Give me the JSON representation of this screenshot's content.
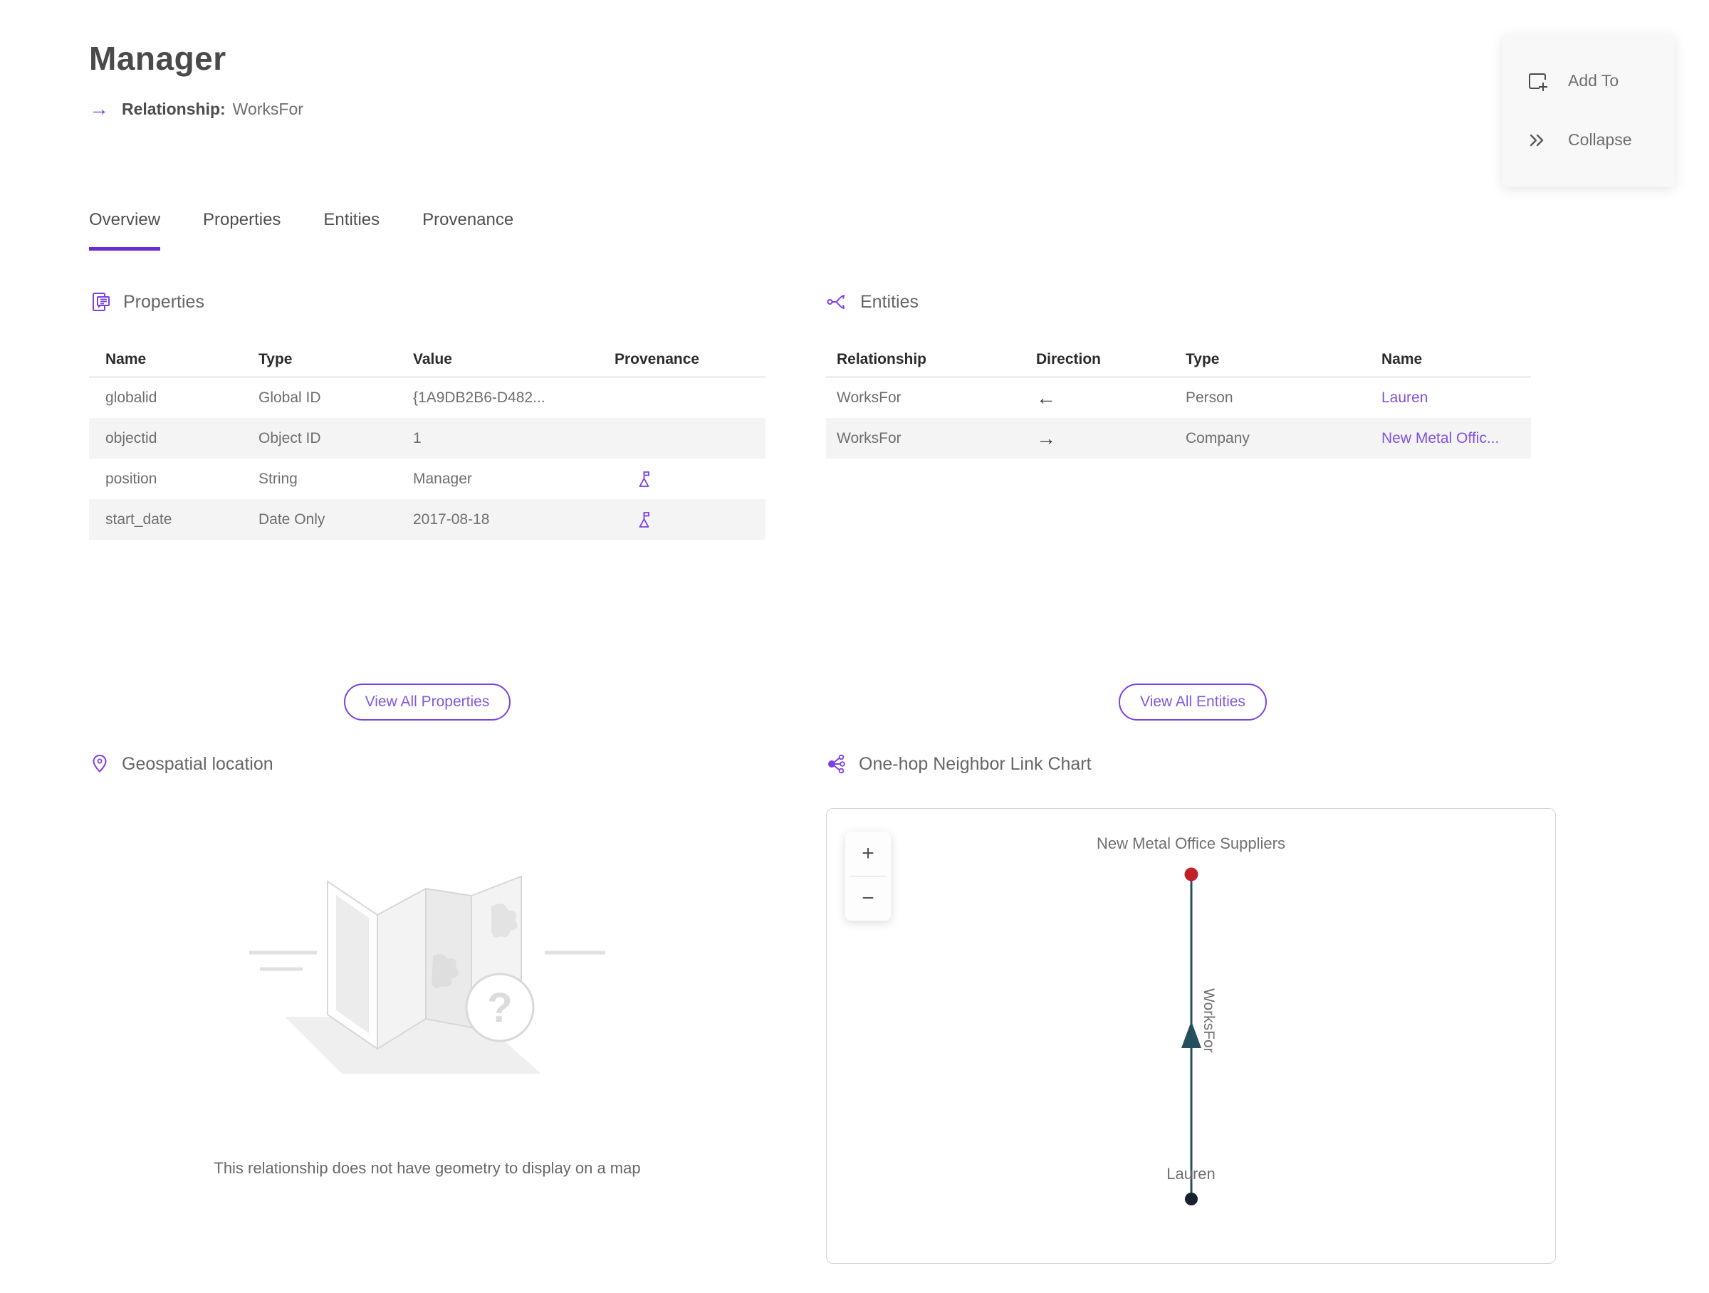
{
  "page": {
    "title": "Manager",
    "subtitle_label": "Relationship:",
    "subtitle_value": "WorksFor"
  },
  "actions": {
    "add_to": "Add To",
    "collapse": "Collapse"
  },
  "tabs": [
    {
      "label": "Overview",
      "active": true
    },
    {
      "label": "Properties",
      "active": false
    },
    {
      "label": "Entities",
      "active": false
    },
    {
      "label": "Provenance",
      "active": false
    }
  ],
  "properties_section": {
    "title": "Properties",
    "columns": [
      "Name",
      "Type",
      "Value",
      "Provenance"
    ],
    "rows": [
      {
        "name": "globalid",
        "type": "Global ID",
        "value": "{1A9DB2B6-D482...",
        "has_provenance_flag": false
      },
      {
        "name": "objectid",
        "type": "Object ID",
        "value": "1",
        "has_provenance_flag": false
      },
      {
        "name": "position",
        "type": "String",
        "value": "Manager",
        "has_provenance_flag": true
      },
      {
        "name": "start_date",
        "type": "Date Only",
        "value": "2017-08-18",
        "has_provenance_flag": true
      }
    ],
    "view_all_label": "View All Properties"
  },
  "entities_section": {
    "title": "Entities",
    "columns": [
      "Relationship",
      "Direction",
      "Type",
      "Name"
    ],
    "rows": [
      {
        "relationship": "WorksFor",
        "direction": "←",
        "type": "Person",
        "name": "Lauren"
      },
      {
        "relationship": "WorksFor",
        "direction": "→",
        "type": "Company",
        "name": "New Metal Offic..."
      }
    ],
    "view_all_label": "View All Entities"
  },
  "geospatial_section": {
    "title": "Geospatial location",
    "empty_message": "This relationship does not have geometry to display on a map"
  },
  "link_chart_section": {
    "title": "One-hop Neighbor Link Chart",
    "zoom_in": "+",
    "zoom_out": "−",
    "top_node": {
      "label": "New Metal Office Suppliers",
      "type": "Company",
      "color": "#c22026"
    },
    "bottom_node": {
      "label": "Lauren",
      "type": "Person",
      "color": "#16222e"
    },
    "edge_label": "WorksFor",
    "edge_color": "#24505d"
  },
  "colors": {
    "accent_purple": "#7b3fe4",
    "link_purple": "#8153e4",
    "tab_underline": "#6a2bd2",
    "zebra_row": "#f4f4f4",
    "edge_teal": "#24505d",
    "node_red": "#c22026",
    "node_dark": "#16222e"
  }
}
